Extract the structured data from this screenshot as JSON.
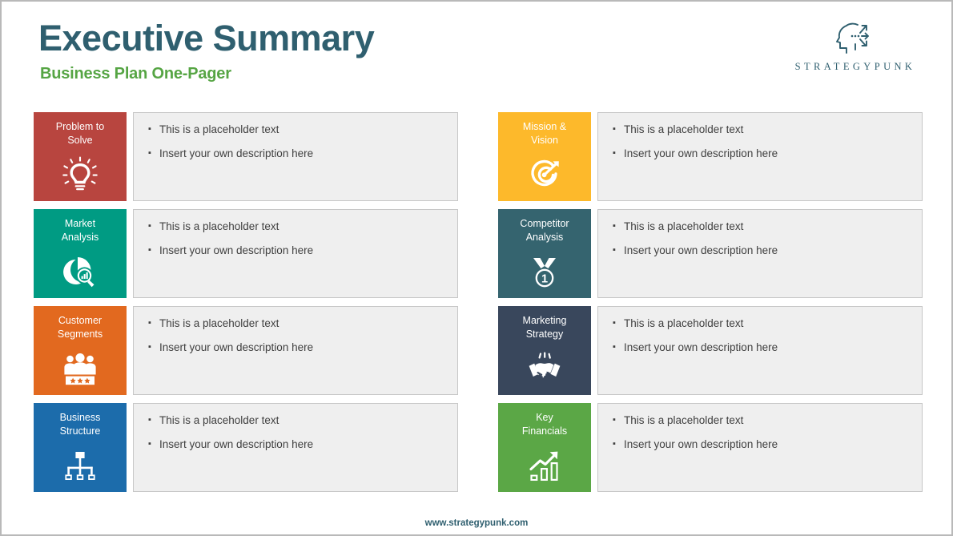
{
  "header": {
    "title": "Executive Summary",
    "subtitle": "Business Plan One-Pager",
    "title_color": "#2f5f6f",
    "subtitle_color": "#56a544"
  },
  "logo": {
    "icon": "head-profile-arrows-icon",
    "wordmark": "STRATEGYPUNK",
    "color": "#2f5f6f"
  },
  "cards": [
    {
      "label": "Problem to Solve",
      "label_line1": "Problem to",
      "label_line2": "Solve",
      "icon": "lightbulb-icon",
      "color": "#b8453f",
      "bullets": [
        "This is a placeholder text",
        "Insert your own description here"
      ]
    },
    {
      "label": "Mission & Vision",
      "label_line1": "Mission &",
      "label_line2": "Vision",
      "icon": "target-dart-icon",
      "color": "#fdb92b",
      "bullets": [
        "This is a placeholder text",
        "Insert your own description here"
      ]
    },
    {
      "label": "Market Analysis",
      "label_line1": "Market",
      "label_line2": "Analysis",
      "icon": "pie-chart-magnifier-icon",
      "color": "#009b83",
      "bullets": [
        "This is a placeholder text",
        "Insert your own description here"
      ]
    },
    {
      "label": "Competitor Analysis",
      "label_line1": "Competitor",
      "label_line2": "Analysis",
      "icon": "medal-ribbon-one-icon",
      "color": "#35646f",
      "bullets": [
        "This is a placeholder text",
        "Insert your own description here"
      ]
    },
    {
      "label": "Customer Segments",
      "label_line1": "Customer",
      "label_line2": "Segments",
      "icon": "people-stars-icon",
      "color": "#e2691f",
      "bullets": [
        "This is a placeholder text",
        "Insert your own description here"
      ]
    },
    {
      "label": "Marketing Strategy",
      "label_line1": "Marketing",
      "label_line2": "Strategy",
      "icon": "handshake-icon",
      "color": "#39475c",
      "bullets": [
        "This is a placeholder text",
        "Insert your own description here"
      ]
    },
    {
      "label": "Business Structure",
      "label_line1": "Business",
      "label_line2": "Structure",
      "icon": "org-chart-icon",
      "color": "#1c6cab",
      "bullets": [
        "This is a placeholder text",
        "Insert your own description here"
      ]
    },
    {
      "label": "Key Financials",
      "label_line1": "Key",
      "label_line2": "Financials",
      "icon": "growth-bar-chart-icon",
      "color": "#5ba746",
      "bullets": [
        "This is a placeholder text",
        "Insert your own description here"
      ]
    }
  ],
  "bullet_glyph": "▪",
  "footer": {
    "url": "www.strategypunk.com"
  }
}
